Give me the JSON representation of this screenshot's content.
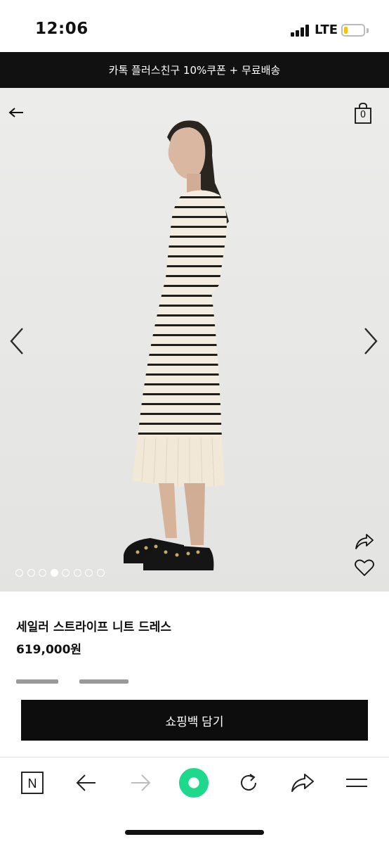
{
  "status_bar": {
    "time": "12:06",
    "network": "LTE",
    "battery_level": 0.2,
    "battery_color": "#f1c40f"
  },
  "promo_banner": {
    "text": "카톡 플러스친구 10%쿠폰 + 무료배송"
  },
  "gallery": {
    "icons": [
      "back-arrow-icon",
      "shopping-bag-icon",
      "chevron-left-icon",
      "chevron-right-icon",
      "share-icon",
      "heart-icon"
    ],
    "cart_count": "0",
    "slide_count": 8,
    "active_slide": 4,
    "image_description_colors": {
      "background": "#ececeb",
      "dress": "#f3ece0",
      "stripe": "#1e1e1e"
    }
  },
  "product": {
    "title": "세일러 스트라이프 니트 드레스",
    "price": "619,000원"
  },
  "actions": {
    "add_to_bag": "쇼핑백 담기"
  },
  "browser_toolbar": {
    "icons": [
      "naver-n-icon",
      "back-arrow-icon",
      "forward-arrow-icon",
      "green-dot-icon",
      "reload-icon",
      "share-arrow-icon",
      "menu-icon"
    ],
    "logo_letter": "N",
    "accent_color": "#1ed98b"
  }
}
